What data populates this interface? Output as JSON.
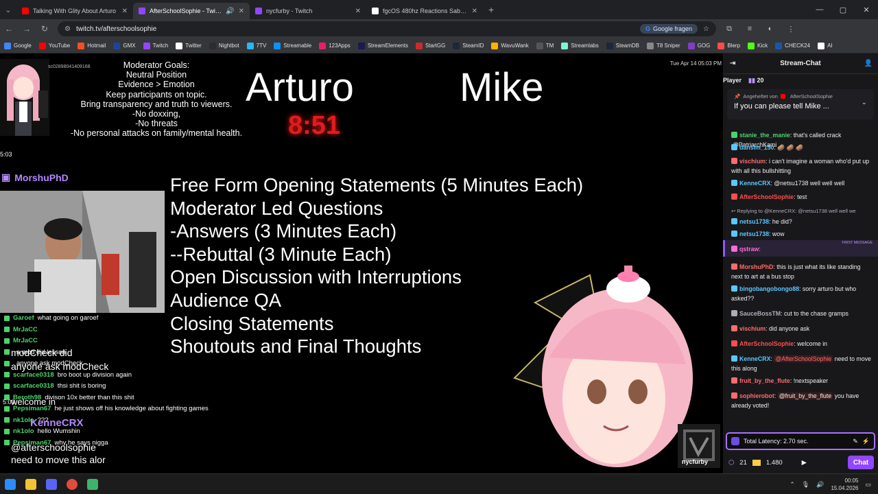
{
  "browser": {
    "tabs": [
      {
        "title": "Talking With Glity About Arturo",
        "color": "#ff0000"
      },
      {
        "title": "AfterSchoolSophie - Twitch",
        "color": "#9147ff",
        "active": true
      },
      {
        "title": "nycfurby - Twitch",
        "color": "#9147ff"
      },
      {
        "title": "fgcOS 480hz Reactions Sabin (X)",
        "color": "#ffffff"
      }
    ],
    "url": "twitch.tv/afterschoolsophie",
    "google_button": "Google fragen",
    "bookmarks": [
      {
        "label": "Google",
        "color": "#4285f4"
      },
      {
        "label": "YouTube",
        "color": "#ff0000"
      },
      {
        "label": "Hotmail",
        "color": "#f25022"
      },
      {
        "label": "GMX",
        "color": "#1c449b"
      },
      {
        "label": "Twitch",
        "color": "#9147ff"
      },
      {
        "label": "Twitter",
        "color": "#ffffff"
      },
      {
        "label": "Nightbot",
        "color": "#2d2d2d"
      },
      {
        "label": "7TV",
        "color": "#29b6f6"
      },
      {
        "label": "Streamable",
        "color": "#0f90fa"
      },
      {
        "label": "123Apps",
        "color": "#e91e63"
      },
      {
        "label": "StreamElements",
        "color": "#1a1a4e"
      },
      {
        "label": "StartGG",
        "color": "#cc2b2b"
      },
      {
        "label": "SteamID",
        "color": "#1b2838"
      },
      {
        "label": "WavuWank",
        "color": "#ffb300"
      },
      {
        "label": "TM",
        "color": "#555555"
      },
      {
        "label": "Streamlabs",
        "color": "#80f5d2"
      },
      {
        "label": "SteamDB",
        "color": "#1b2838"
      },
      {
        "label": "T8 Sniper",
        "color": "#888888"
      },
      {
        "label": "GOG",
        "color": "#7f3ec5"
      },
      {
        "label": "Blerp",
        "color": "#ff4d4d"
      },
      {
        "label": "Kick",
        "color": "#53fc18"
      },
      {
        "label": "CHECK24",
        "color": "#1a56a6"
      },
      {
        "label": "AI",
        "color": "#ffffff"
      }
    ]
  },
  "stream": {
    "moderator_goals": [
      "Moderator Goals:",
      "Neutral Position",
      "Evidence > Emotion",
      "Keep participants on topic.",
      "Bring transparency and truth to viewers.",
      "-No doxxing,",
      "-No threats",
      "-No personal attacks on family/mental health."
    ],
    "id_text": "sc02898041409168",
    "timestamp": "Tue Apr 14 05:03 PM",
    "debater_left": "Arturo",
    "debater_right": "Mike",
    "timer": "8:51",
    "agenda": [
      "Free Form Opening Statements (5 Minutes Each)",
      "Moderator Led Questions",
      "-Answers (3 Minutes Each)",
      "--Rebuttal (3 Minute Each)",
      "Open Discussion with Interruptions",
      "Audience QA",
      "Closing Statements",
      "Shoutouts and Final Thoughts"
    ],
    "overlay_time": "5:03",
    "overlay_time2": "5:03",
    "overlay_username": "MorshuPhD",
    "overlay_big_username": "KenneCRX",
    "overlay_big1": "modCheck did",
    "overlay_big2": "anyone ask modCheck",
    "overlay_big3": "welcome in",
    "overlay_big4": "@afterschoolsophie",
    "overlay_big5": "need to move this alor",
    "logo_text": "nycfurby",
    "overlay_chat": [
      {
        "user": "Garoef",
        "text": "what going on garoef"
      },
      {
        "user": "MrJaCC",
        "text": ""
      },
      {
        "user": "MrJaCC",
        "text": ""
      },
      {
        "user": "",
        "text": "a mod did lesson"
      },
      {
        "user": "",
        "text": "anyone ask modCheck"
      },
      {
        "user": "scarface0318",
        "text": "bro boot up division again"
      },
      {
        "user": "scarface0318",
        "text": "thsi shit is boring"
      },
      {
        "user": "Beroth98",
        "text": "divison 10x better than this shit"
      },
      {
        "user": "Pepsiman67",
        "text": "he just shows off his knowledge about fighting games"
      },
      {
        "user": "nk1olo",
        "text": "???"
      },
      {
        "user": "nk1olo",
        "text": "hello Wumshin"
      },
      {
        "user": "Pepsiman67",
        "text": "why he says nigga"
      }
    ]
  },
  "chat_panel": {
    "title": "Stream-Chat",
    "player_label": "Player",
    "player_count": "20",
    "pinned_by": "Angeheftet von",
    "pinned_user": "AfterSchoolSophie",
    "pinned_text": "If you can please tell Mike ...",
    "first_message_label": "FIRST MESSAGE",
    "messages": [
      {
        "user": "stanie_the_manie",
        "color": "#4bd36b",
        "text": "that's called crack",
        "mention": "@PatriarchKami"
      },
      {
        "user": "dansim_150",
        "color": "#5bc7ff",
        "text": "🥔 🥔 🥔"
      },
      {
        "user": "vischium",
        "color": "#ff6b6b",
        "text": "i can't imagine a woman who'd put up with all this bullshitting"
      },
      {
        "user": "KenneCRX",
        "color": "#5bc7ff",
        "text": "@netsu1738 well well well"
      },
      {
        "user": "AfterSchoolSophie",
        "color": "#ff4d4d",
        "text": "test"
      },
      {
        "user": "",
        "color": "#adadb8",
        "text": "Replying to @KenneCRX: @netsu1738 well well we"
      },
      {
        "user": "netsu1738",
        "color": "#5bc7ff",
        "text": "he did?"
      },
      {
        "user": "netsu1738",
        "color": "#5bc7ff",
        "text": "wow"
      },
      {
        "user": "qstraw",
        "color": "#ff6bd5",
        "text": ""
      },
      {
        "user": "MorshuPhD",
        "color": "#ff6b6b",
        "text": "this is just what its like standing next to art at a bus stop"
      },
      {
        "user": "bingobangobongo88",
        "color": "#5bc7ff",
        "text": "sorry arturo but who asked??"
      },
      {
        "user": "SauceBossTM",
        "color": "#adadb8",
        "text": "cut to the chase gramps"
      },
      {
        "user": "vischium",
        "color": "#ff6b6b",
        "text": "did anyone ask"
      },
      {
        "user": "AfterSchoolSophie",
        "color": "#ff4d4d",
        "text": "welcome in"
      },
      {
        "user": "KenneCRX",
        "color": "#5bc7ff",
        "text": "need to move this along",
        "mention": "@AfterSchoolSophie"
      },
      {
        "user": "fruit_by_the_flute",
        "color": "#ff6b6b",
        "text": "!nextspeaker"
      },
      {
        "user": "sophierobot",
        "color": "#ff6b6b",
        "text": "you have already voted!",
        "mention": "@fruit_by_the_flute"
      }
    ],
    "input_text": "Total Latency: 2.70 sec.",
    "points": "21",
    "channel_points": "1.480",
    "chat_button": "Chat"
  },
  "taskbar": {
    "time": "00:05",
    "date": "15.04.2026"
  }
}
